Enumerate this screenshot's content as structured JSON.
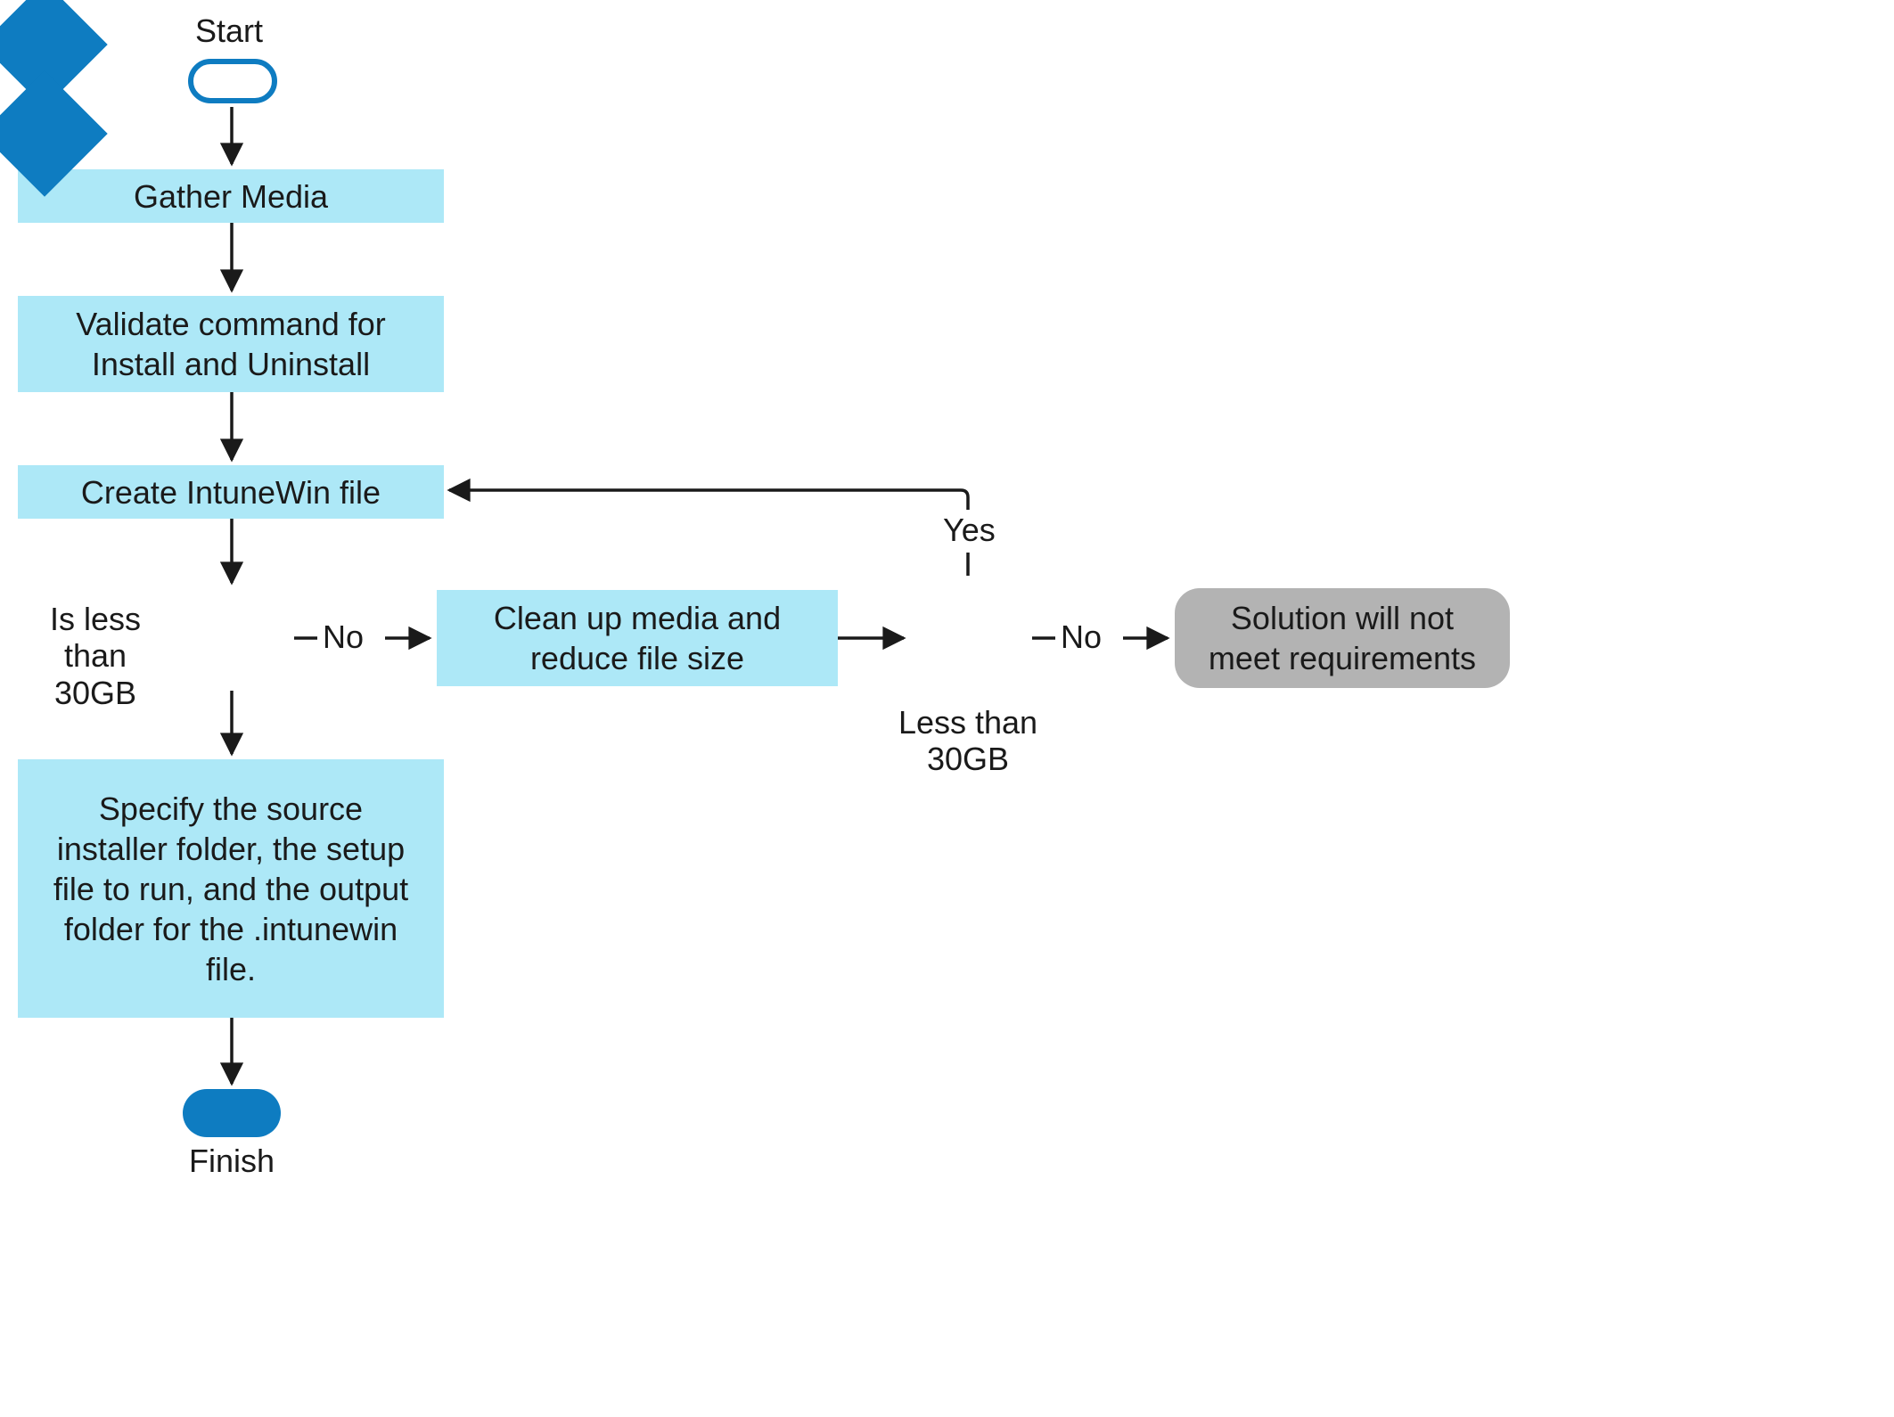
{
  "labels": {
    "start": "Start",
    "gather_media": "Gather Media",
    "validate_cmd": "Validate command for Install and Uninstall",
    "create_intunewin": "Create IntuneWin file",
    "decision1_label": "Is less than 30GB",
    "no1": "No",
    "cleanup": "Clean up media and reduce file size",
    "decision2_label": "Less than 30GB",
    "yes": "Yes",
    "no2": "No",
    "solution_fail": "Solution will not meet requirements",
    "specify": "Specify the source installer folder, the setup file to run, and the output folder for the .intunewin file.",
    "finish": "Finish"
  }
}
